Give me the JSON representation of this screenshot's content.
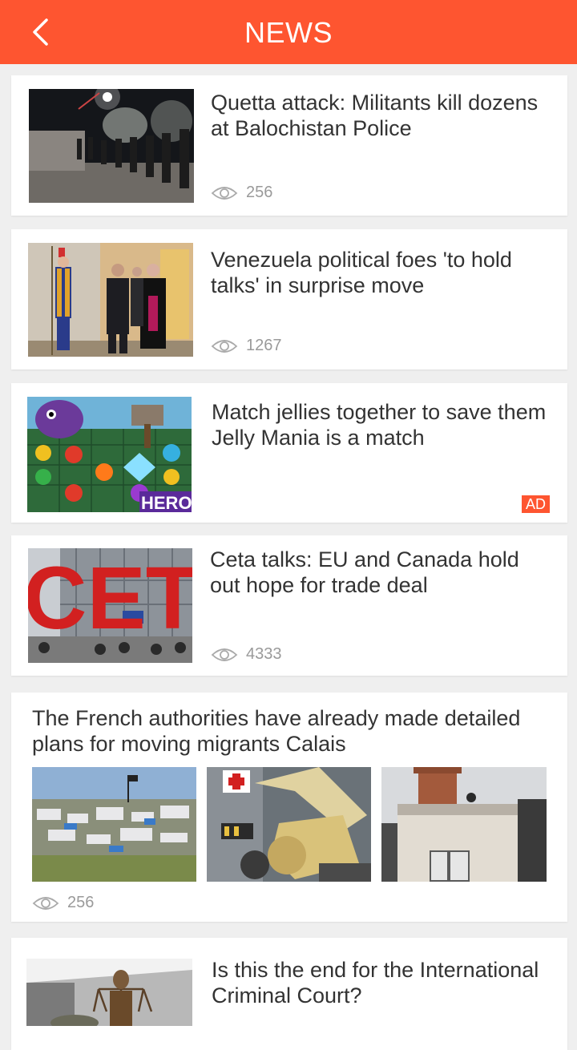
{
  "header": {
    "title": "NEWS",
    "back_icon": "chevron-left-icon"
  },
  "colors": {
    "accent": "#fe5530",
    "background": "#efefef",
    "card": "#ffffff",
    "text": "#333333",
    "meta": "#9a9a9a"
  },
  "feed": [
    {
      "headline": "Quetta attack: Militants kill dozens at Balochistan Police",
      "views": "256"
    },
    {
      "headline": "Venezuela political foes 'to hold talks' in surprise move",
      "views": "1267"
    },
    {
      "headline": "Match jellies together to save them Jelly Mania is a match",
      "ad_label": "AD",
      "image_text": "HERO"
    },
    {
      "headline": "Ceta talks: EU and Canada hold out hope for trade deal",
      "views": "4333",
      "image_text": "CETA"
    },
    {
      "headline": "The French authorities have already made detailed plans for moving migrants Calais",
      "views": "256"
    },
    {
      "headline": "Is this the end for the International Criminal Court?"
    }
  ]
}
